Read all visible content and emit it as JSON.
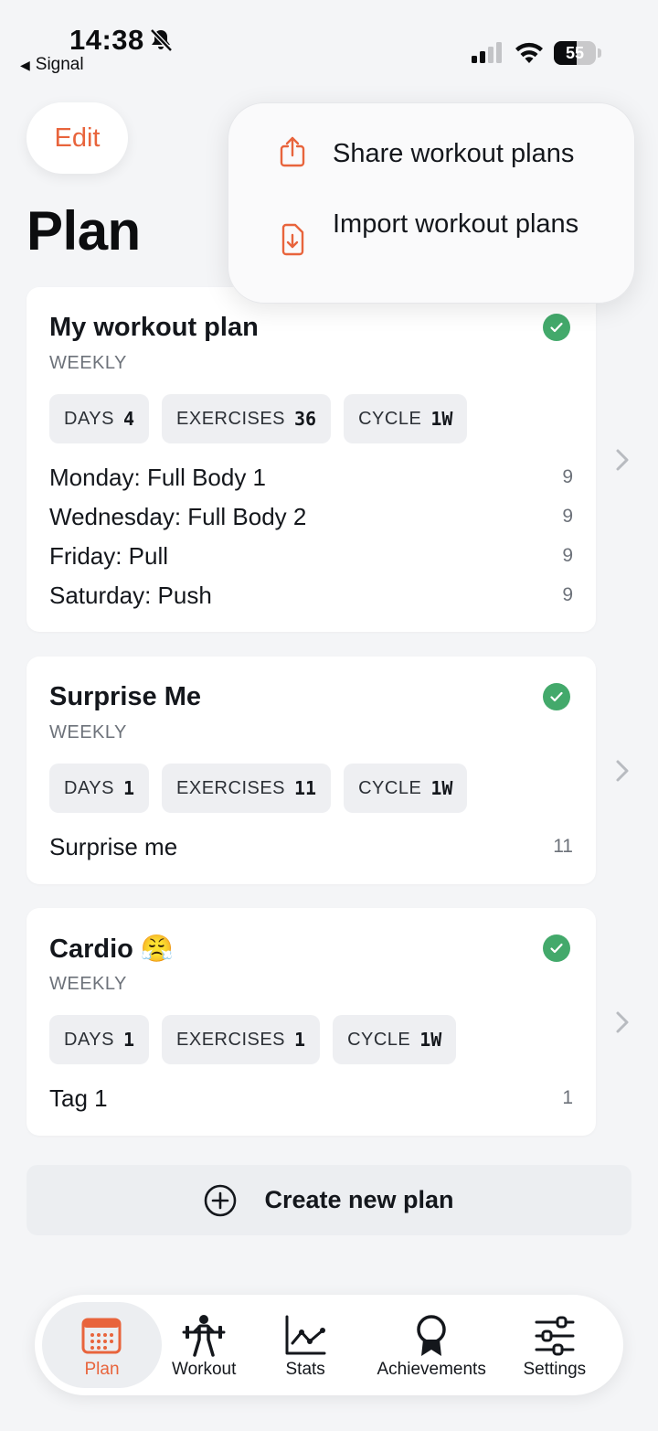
{
  "status_bar": {
    "time": "14:38",
    "back_app": "Signal",
    "battery": "55",
    "battery_level": 0.55
  },
  "header": {
    "edit_label": "Edit",
    "title": "Plan"
  },
  "popup_menu": {
    "items": [
      {
        "label": "Share workout plans",
        "icon": "share-icon"
      },
      {
        "label": "Import workout plans",
        "icon": "file-download-icon"
      }
    ]
  },
  "plans": [
    {
      "title": "My workout plan",
      "subtitle": "WEEKLY",
      "chips": [
        {
          "label": "DAYS",
          "value": "4"
        },
        {
          "label": "EXERCISES",
          "value": "36"
        },
        {
          "label": "CYCLE",
          "value": "1W"
        }
      ],
      "days": [
        {
          "name": "Monday: Full Body 1",
          "count": "9"
        },
        {
          "name": "Wednesday: Full Body 2",
          "count": "9"
        },
        {
          "name": "Friday: Pull",
          "count": "9"
        },
        {
          "name": "Saturday: Push",
          "count": "9"
        }
      ]
    },
    {
      "title": "Surprise Me",
      "subtitle": "WEEKLY",
      "chips": [
        {
          "label": "DAYS",
          "value": "1"
        },
        {
          "label": "EXERCISES",
          "value": "11"
        },
        {
          "label": "CYCLE",
          "value": "1W"
        }
      ],
      "days": [
        {
          "name": "Surprise me",
          "count": "11"
        }
      ]
    },
    {
      "title": "Cardio 😤",
      "subtitle": "WEEKLY",
      "chips": [
        {
          "label": "DAYS",
          "value": "1"
        },
        {
          "label": "EXERCISES",
          "value": "1"
        },
        {
          "label": "CYCLE",
          "value": "1W"
        }
      ],
      "days": [
        {
          "name": "Tag 1",
          "count": "1"
        }
      ]
    }
  ],
  "create_button": {
    "label": "Create new plan"
  },
  "tabbar": {
    "tabs": [
      {
        "label": "Plan",
        "icon": "calendar-icon",
        "active": true
      },
      {
        "label": "Workout",
        "icon": "weightlifter-icon",
        "active": false
      },
      {
        "label": "Stats",
        "icon": "line-chart-icon",
        "active": false
      },
      {
        "label": "Achievements",
        "icon": "award-icon",
        "active": false
      },
      {
        "label": "Settings",
        "icon": "sliders-icon",
        "active": false
      }
    ]
  },
  "colors": {
    "accent": "#e8643c",
    "check": "#43a96b",
    "background": "#f4f5f7"
  }
}
